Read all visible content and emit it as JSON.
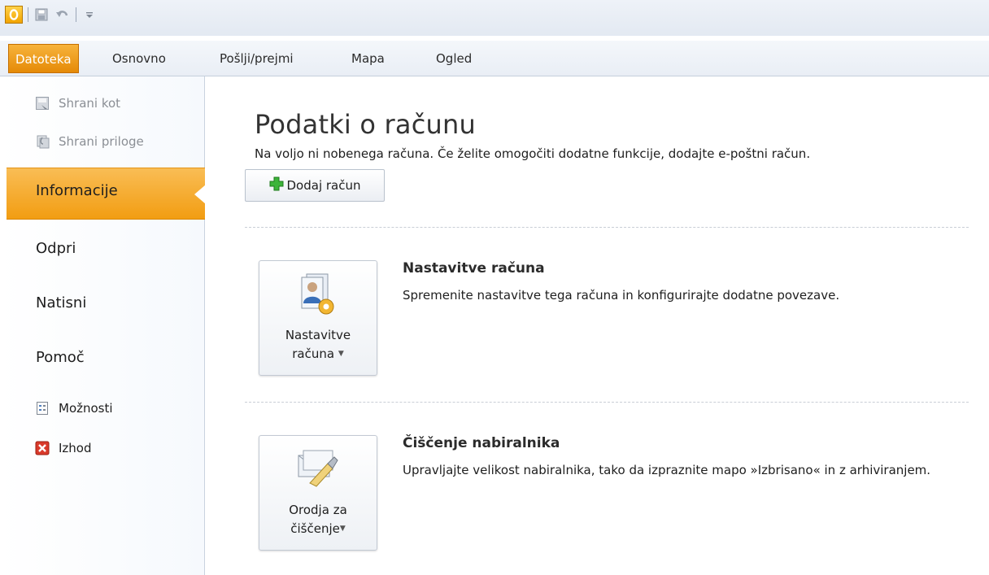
{
  "window": {
    "app_icon": "outlook-icon",
    "qat_icons": [
      "save-icon",
      "undo-icon",
      "customize-qat-icon"
    ]
  },
  "ribbon": {
    "tabs": [
      {
        "label": "Datoteka",
        "active": true
      },
      {
        "label": "Osnovno"
      },
      {
        "label": "Pošlji/prejmi"
      },
      {
        "label": "Mapa"
      },
      {
        "label": "Ogled"
      }
    ],
    "accent_color": "#f29d12"
  },
  "backstage_nav": {
    "commands_top": [
      {
        "label": "Shrani kot",
        "icon": "save-as-icon",
        "enabled": false
      },
      {
        "label": "Shrani priloge",
        "icon": "save-attachments-icon",
        "enabled": false
      }
    ],
    "tabs": [
      {
        "label": "Informacije",
        "selected": true
      },
      {
        "label": "Odpri"
      },
      {
        "label": "Natisni"
      },
      {
        "label": "Pomoč"
      }
    ],
    "commands_bottom": [
      {
        "label": "Možnosti",
        "icon": "options-icon"
      },
      {
        "label": "Izhod",
        "icon": "exit-icon"
      }
    ]
  },
  "info_page": {
    "title": "Podatki o računu",
    "description": "Na voljo ni nobenega računa. Če želite omogočiti dodatne funkcije, dodajte e-poštni račun.",
    "add_account_label": "Dodaj račun",
    "sections": [
      {
        "button_label_line1": "Nastavitve",
        "button_label_line2": "računa",
        "icon": "account-settings-icon",
        "title": "Nastavitve računa",
        "description": "Spremenite nastavitve tega računa in konfigurirajte dodatne povezave."
      },
      {
        "button_label_line1": "Orodja za",
        "button_label_line2": "čiščenje",
        "icon": "cleanup-tools-icon",
        "title": "Čiščenje nabiralnika",
        "description": "Upravljajte velikost nabiralnika, tako da izpraznite mapo »Izbrisano« in z arhiviranjem."
      }
    ]
  }
}
